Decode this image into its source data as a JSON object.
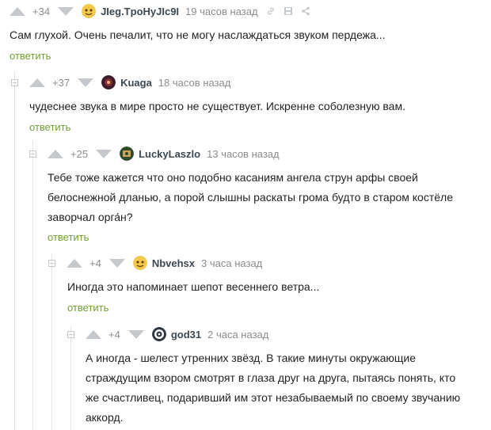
{
  "comments": [
    {
      "rating": "+34",
      "author": "JIeg.TpoHyJIc9I",
      "time": "19 часов назад",
      "text": "Сам глухой. Очень печалит, что не могу наслаждаться звуком пердежа...",
      "reply": "ответить"
    },
    {
      "rating": "+37",
      "author": "Kuaga",
      "time": "18 часов назад",
      "text": "чудеснее звука в мире просто не существует. Искренне соболезную вам.",
      "reply": "ответить"
    },
    {
      "rating": "+25",
      "author": "LuckyLaszlo",
      "time": "13 часов назад",
      "text_lines": [
        "Тебе тоже кажется что оно подобно касаниям ангела струн арфы своей",
        "белоснежной дланью, а порой слышны раскаты грома будто в старом костёле",
        "заворчал орга́н?"
      ],
      "reply": "ответить"
    },
    {
      "rating": "+4",
      "author": "Nbvehsx",
      "time": "3 часа назад",
      "text": "Иногда это напоминает шепот весеннего ветра...",
      "reply": "ответить"
    },
    {
      "rating": "+4",
      "author": "god31",
      "time": "2 часа назад",
      "text_lines": [
        "А иногда - шелест утренних звёзд. В такие минуты окружающие",
        "страждущим взором смотрят в глаза друг на друга, пытаясь понять, кто",
        "же счастливец, подаривший им этот незабываемый по своему звучанию",
        "аккорд."
      ]
    }
  ],
  "colors": {
    "reply_link": "#6f9f2d",
    "vote_arrow": "#c5c8cc",
    "meta_text": "#8c8c8c",
    "branch_line": "#e4e4e4"
  },
  "icons": [
    "collapse-icon",
    "upvote-icon",
    "downvote-icon",
    "avatar",
    "link-icon",
    "save-icon",
    "share-icon"
  ]
}
